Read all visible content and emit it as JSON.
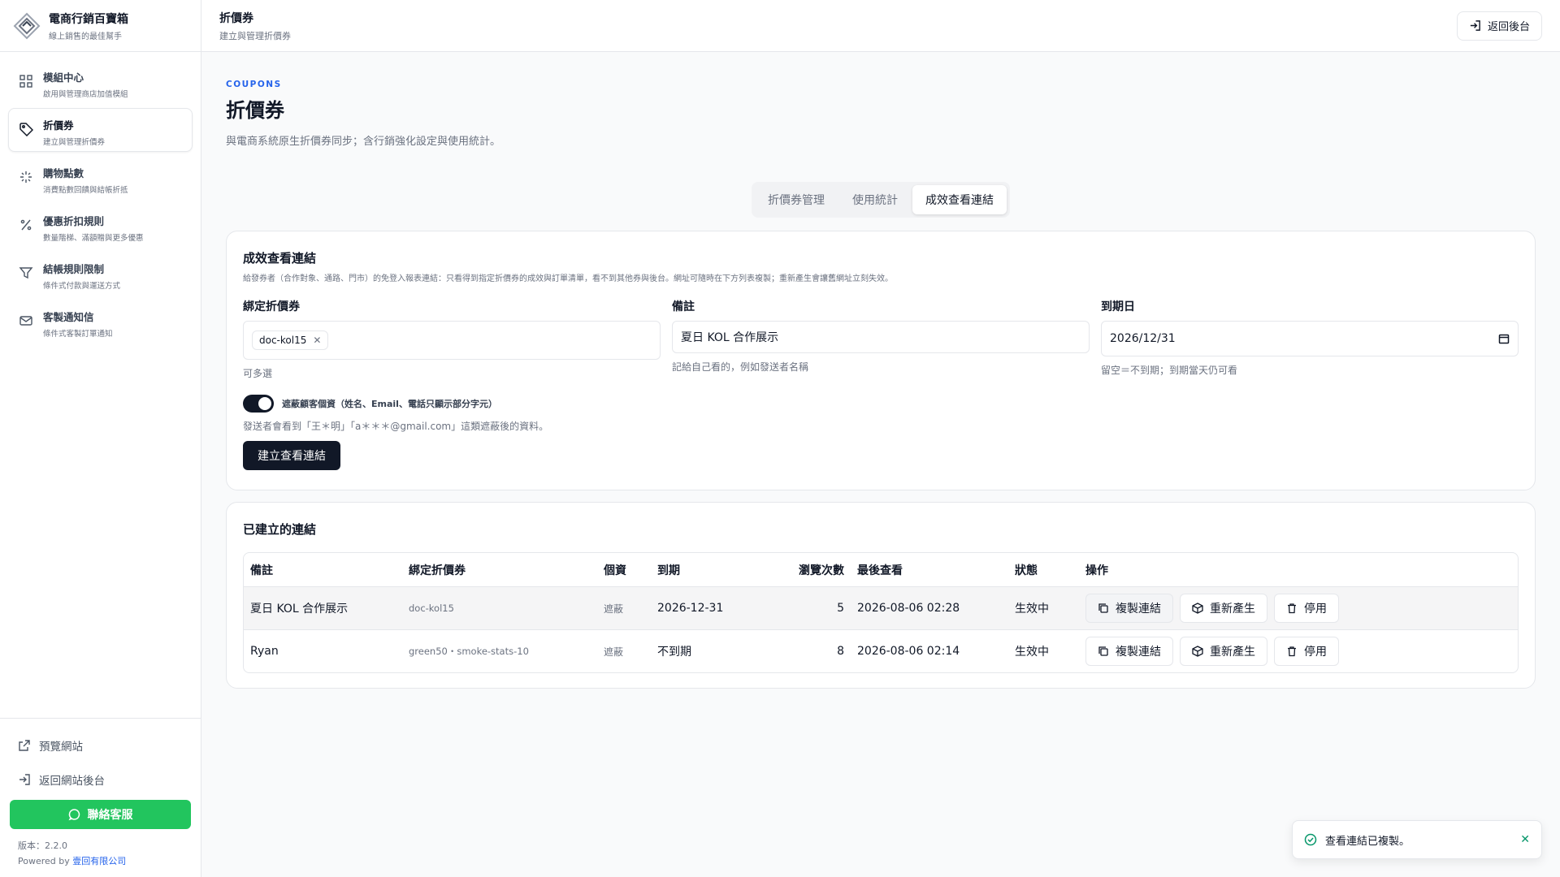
{
  "sidebar": {
    "brand_title": "電商行銷百寶箱",
    "brand_sub": "線上銷售的最佳幫手",
    "items": [
      {
        "label": "模組中心",
        "desc": "啟用與管理商店加值模組",
        "icon": "grid-icon"
      },
      {
        "label": "折價券",
        "desc": "建立與管理折價券",
        "icon": "tag-icon"
      },
      {
        "label": "購物點數",
        "desc": "消費點數回饋與結帳折抵",
        "icon": "sparkle-icon"
      },
      {
        "label": "優惠折扣規則",
        "desc": "數量階梯、滿額贈與更多優惠",
        "icon": "percent-icon"
      },
      {
        "label": "結帳規則限制",
        "desc": "條件式付款與運送方式",
        "icon": "filter-icon"
      },
      {
        "label": "客製通知信",
        "desc": "條件式客製訂單通知",
        "icon": "mail-icon"
      }
    ],
    "preview_site": "預覽網站",
    "back_to_site_admin": "返回網站後台",
    "support": "聯絡客服",
    "version": "版本：2.2.0",
    "powered_prefix": "Powered by",
    "powered_company": "壹回有限公司"
  },
  "topbar": {
    "title": "折價券",
    "subtitle": "建立與管理折價券",
    "back_button": "返回後台"
  },
  "page": {
    "eyebrow": "COUPONS",
    "title": "折價券",
    "description": "與電商系統原生折價券同步；含行銷強化設定與使用統計。"
  },
  "tabs": [
    "折價券管理",
    "使用統計",
    "成效查看連結"
  ],
  "form": {
    "title": "成效查看連結",
    "description": "給發券者（合作對象、通路、門市）的免登入報表連結：只看得到指定折價券的成效與訂單清單，看不到其他券與後台。網址可隨時在下方列表複製；重新產生會讓舊網址立刻失效。",
    "coupon_label": "綁定折價券",
    "coupon_chip": "doc-kol15",
    "coupon_hint": "可多選",
    "note_label": "備註",
    "note_value": "夏日 KOL 合作展示",
    "note_hint": "記給自己看的，例如發送者名稱",
    "expiry_label": "到期日",
    "expiry_value": "2026/12/31",
    "expiry_hint": "留空＝不到期；到期當天仍可看",
    "mask_label": "遮蔽顧客個資（姓名、Email、電話只顯示部分字元）",
    "mask_note": "發送者會看到「王＊明」「a＊＊＊@gmail.com」這類遮蔽後的資料。",
    "submit": "建立查看連結"
  },
  "links": {
    "title": "已建立的連結",
    "columns": [
      "備註",
      "綁定折價券",
      "個資",
      "到期",
      "瀏覽次數",
      "最後查看",
      "狀態",
      "操作"
    ],
    "rows": [
      {
        "note": "夏日 KOL 合作展示",
        "coupons": "doc-kol15",
        "privacy": "遮蔽",
        "expiry": "2026-12-31",
        "views": "5",
        "last_viewed": "2026-08-06 02:28",
        "status": "生效中"
      },
      {
        "note": "Ryan",
        "coupons": "green50・smoke-stats-10",
        "privacy": "遮蔽",
        "expiry": "不到期",
        "views": "8",
        "last_viewed": "2026-08-06 02:14",
        "status": "生效中"
      }
    ],
    "actions": {
      "copy": "複製連結",
      "regenerate": "重新產生",
      "disable": "停用"
    }
  },
  "toast": {
    "message": "查看連結已複製。"
  },
  "colors": {
    "accent": "#2563eb",
    "support": "#22c55e",
    "dark": "#111827"
  }
}
